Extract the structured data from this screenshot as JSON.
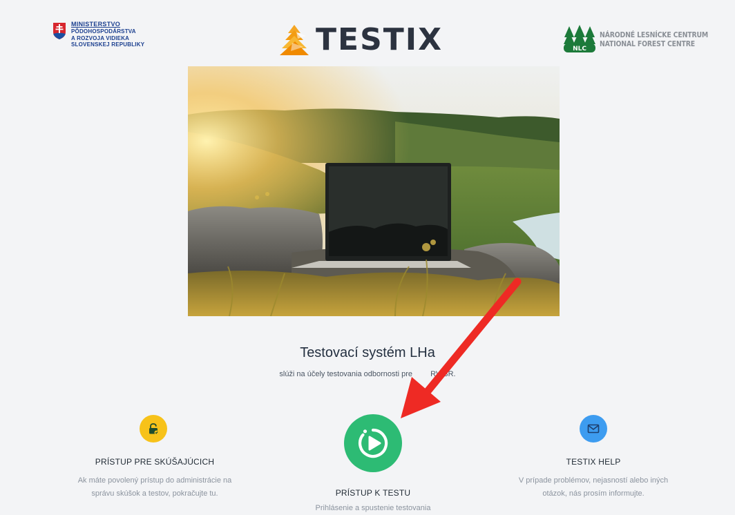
{
  "header": {
    "ministry": {
      "line1": "MINISTERSTVO",
      "line2": "PÔDOHOSPODÁRSTVA",
      "line3": "A ROZVOJA VIDIEKA",
      "line4": "SLOVENSKEJ REPUBLIKY"
    },
    "app_name": "TESTIX",
    "nlc": {
      "line1": "NÁRODNÉ LESNÍCKE CENTRUM",
      "line2": "NATIONAL FOREST CENTRE",
      "emblem_text": "NLC"
    }
  },
  "hero": {
    "title": "Testovací systém LHa",
    "subtitle": "slúži na účely testovania odbornosti pre",
    "subtitle_end": "RV SR."
  },
  "cards": {
    "examiners": {
      "icon": "lock-icon",
      "heading": "PRÍSTUP PRE SKÚŠAJÚCICH",
      "desc_line1": "Ak máte povolený prístup do administrácie na",
      "desc_line2": "správu skúšok a testov, pokračujte tu."
    },
    "test": {
      "icon": "play-icon",
      "heading": "PRÍSTUP K TESTU",
      "desc_line1": "Prihlásenie a spustenie testovania"
    },
    "help": {
      "icon": "mail-icon",
      "heading": "TESTIX HELP",
      "desc_line1": "V prípade problémov, nejasností alebo iných",
      "desc_line2": "otázok, nás prosím informujte."
    }
  },
  "colors": {
    "background": "#f3f4f6",
    "yellow": "#f7c21a",
    "green": "#2dbb74",
    "blue": "#3d9cf0",
    "annotation_arrow": "#ee2a24"
  }
}
